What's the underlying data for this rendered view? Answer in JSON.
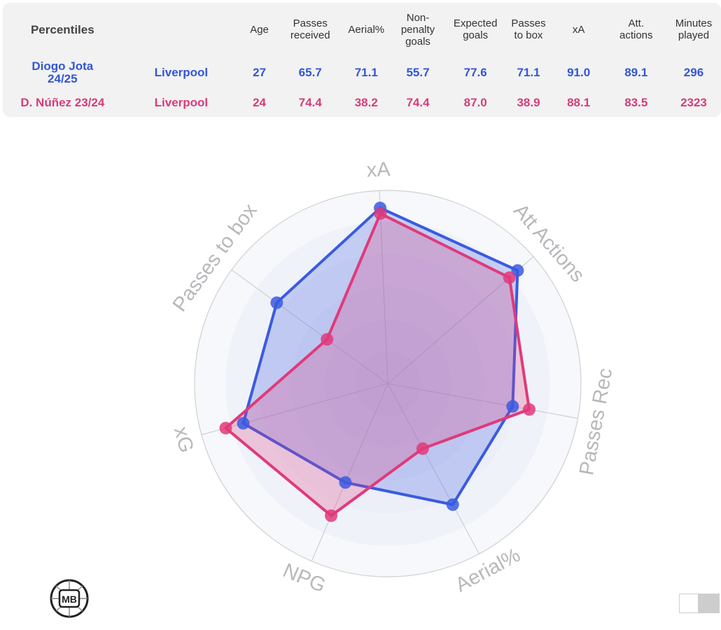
{
  "table": {
    "header": [
      "Percentiles",
      "",
      "Age",
      "Passes\nreceived",
      "Aerial%",
      "Non-\npenalty\ngoals",
      "Expected\ngoals",
      "Passes\nto box",
      "xA",
      "Att.\nactions",
      "Minutes\nplayed"
    ],
    "rows": [
      {
        "player": "Diogo Jota\n24/25",
        "team": "Liverpool",
        "values": [
          "27",
          "65.7",
          "71.1",
          "55.7",
          "77.6",
          "71.1",
          "91.0",
          "89.1",
          "296"
        ],
        "color": "#3356d6"
      },
      {
        "player": "D. Núñez 23/24",
        "team": "Liverpool",
        "values": [
          "24",
          "74.4",
          "38.2",
          "74.4",
          "87.0",
          "38.9",
          "88.1",
          "83.5",
          "2323"
        ],
        "color": "#d63c7a"
      }
    ]
  },
  "chart_data": {
    "type": "radar",
    "axes": [
      "xA",
      "Att Actions",
      "Passes Rec",
      "Aerial%",
      "NPG",
      "xG",
      "Passes to box"
    ],
    "range": [
      0,
      100
    ],
    "series": [
      {
        "name": "Diogo Jota 24/25",
        "color": "#3a5be0",
        "values": [
          91.0,
          89.1,
          65.7,
          71.1,
          55.7,
          77.6,
          71.1
        ]
      },
      {
        "name": "D. Núñez 23/24",
        "color": "#e03a7a",
        "values": [
          88.1,
          83.5,
          74.4,
          38.2,
          74.4,
          87.0,
          38.9
        ]
      }
    ]
  },
  "logo": {
    "text": "MB"
  },
  "icons": {
    "logo": "mb-ball-logo",
    "toggle": "toggle-switch"
  }
}
